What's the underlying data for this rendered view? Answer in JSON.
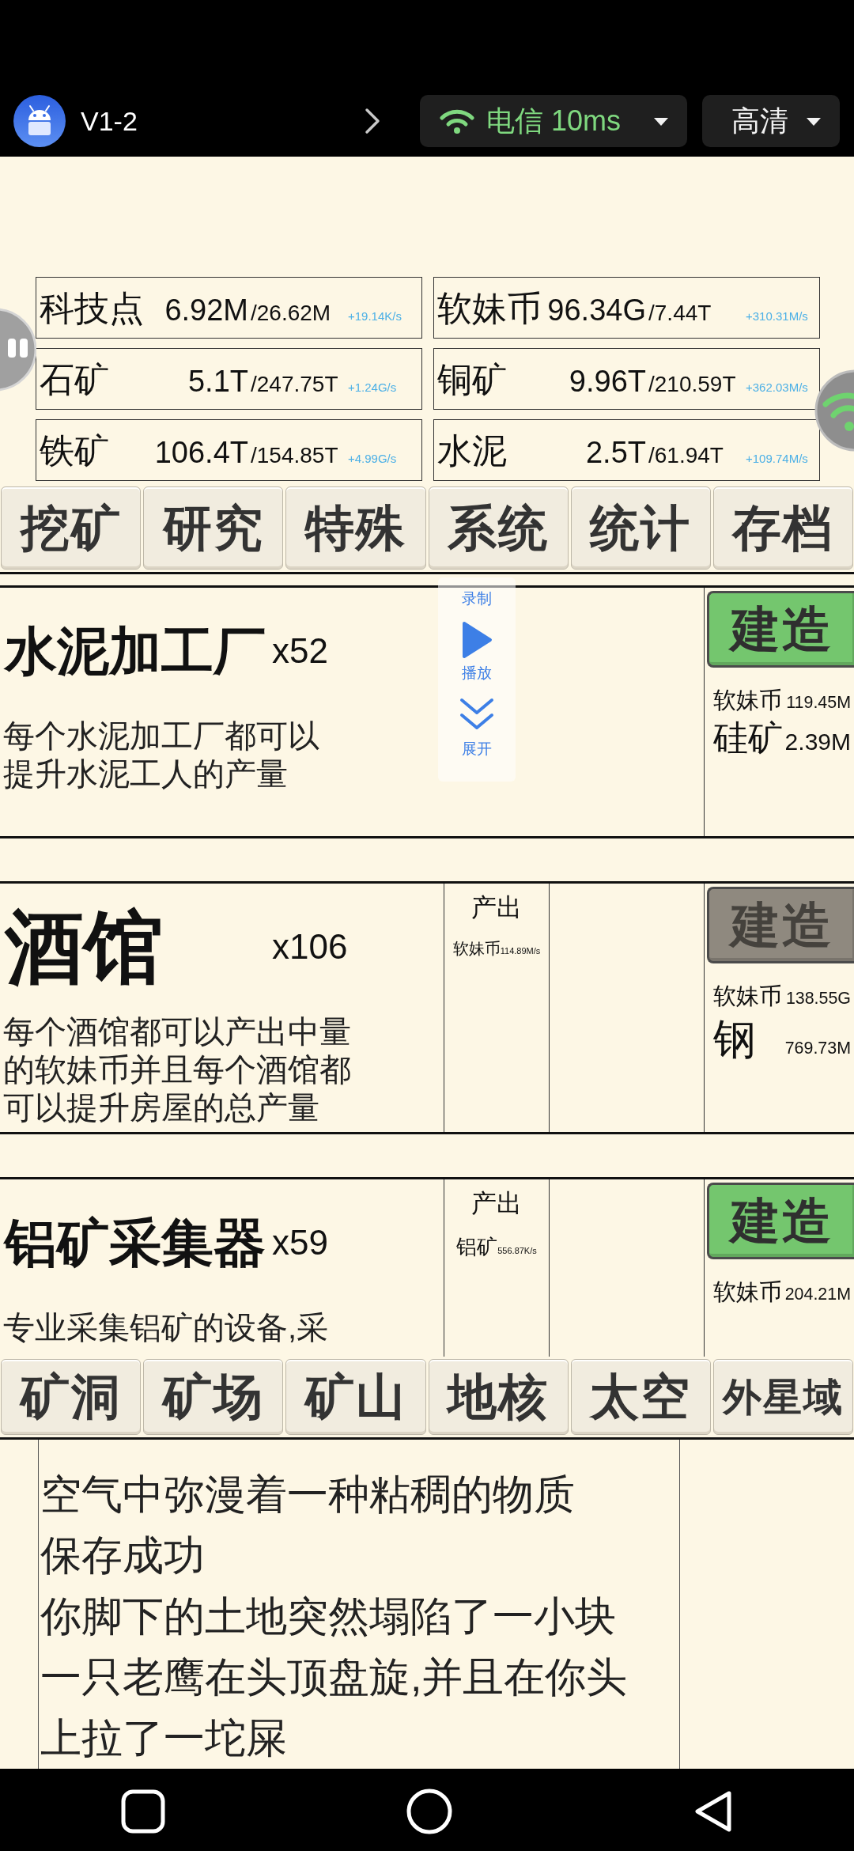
{
  "top_bar": {
    "app_title": "V1-2",
    "network": {
      "label": "电信 10ms"
    },
    "quality": {
      "label": "高清"
    }
  },
  "resources": [
    {
      "name": "科技点",
      "amount": "6.92M",
      "capacity": "/26.62M",
      "rate": "+19.14K/s"
    },
    {
      "name": "软妹币",
      "amount": "96.34G",
      "capacity": "/7.44T",
      "rate": "+310.31M/s"
    },
    {
      "name": "石矿",
      "amount": "5.1T",
      "capacity": "/247.75T",
      "rate": "+1.24G/s"
    },
    {
      "name": "铜矿",
      "amount": "9.96T",
      "capacity": "/210.59T",
      "rate": "+362.03M/s"
    },
    {
      "name": "铁矿",
      "amount": "106.4T",
      "capacity": "/154.85T",
      "rate": "+4.99G/s"
    },
    {
      "name": "水泥",
      "amount": "2.5T",
      "capacity": "/61.94T",
      "rate": "+109.74M/s"
    }
  ],
  "main_tabs": [
    {
      "label": "挖矿"
    },
    {
      "label": "研究"
    },
    {
      "label": "特殊"
    },
    {
      "label": "系统"
    },
    {
      "label": "统计"
    },
    {
      "label": "存档"
    }
  ],
  "buildings": [
    {
      "name": "水泥加工厂",
      "count": "x52",
      "description_lines": [
        "每个水泥加工厂都可以",
        "提升水泥工人的产量"
      ],
      "build_button": {
        "label": "建造",
        "disabled": false
      },
      "costs": [
        {
          "name": "软妹币",
          "amount": "119.45M"
        },
        {
          "name": "硅矿",
          "amount": "2.39M"
        }
      ]
    },
    {
      "name": "酒馆",
      "count": "x106",
      "description_lines": [
        "每个酒馆都可以产出中量",
        "的软妹币并且每个酒馆都",
        "可以提升房屋的总产量"
      ],
      "output": {
        "label": "产出",
        "items": [
          {
            "name": "软妹币",
            "rate": "114.89M/s"
          }
        ]
      },
      "build_button": {
        "label": "建造",
        "disabled": true
      },
      "costs": [
        {
          "name": "软妹币",
          "amount": "138.55G"
        },
        {
          "name": "钢",
          "amount": "769.73M"
        }
      ]
    },
    {
      "name": "铝矿采集器",
      "count": "x59",
      "description_lines": [
        "专业采集铝矿的设备,采"
      ],
      "output": {
        "label": "产出",
        "items": [
          {
            "name": "铝矿",
            "rate": "556.87K/s"
          }
        ]
      },
      "build_button": {
        "label": "建造",
        "disabled": false
      },
      "costs": [
        {
          "name": "软妹币",
          "amount": "204.21M"
        }
      ]
    }
  ],
  "area_tabs": [
    {
      "label": "矿洞"
    },
    {
      "label": "矿场"
    },
    {
      "label": "矿山"
    },
    {
      "label": "地核"
    },
    {
      "label": "太空"
    },
    {
      "label": "外星域"
    }
  ],
  "log": [
    "空气中弥漫着一种粘稠的物质",
    "保存成功",
    "你脚下的土地突然塌陷了一小块",
    "一只老鹰在头顶盘旋,并且在你头上拉了一坨屎"
  ],
  "recorder_widget": {
    "title": "录制",
    "play_label": "播放",
    "expand_label": "展开"
  }
}
